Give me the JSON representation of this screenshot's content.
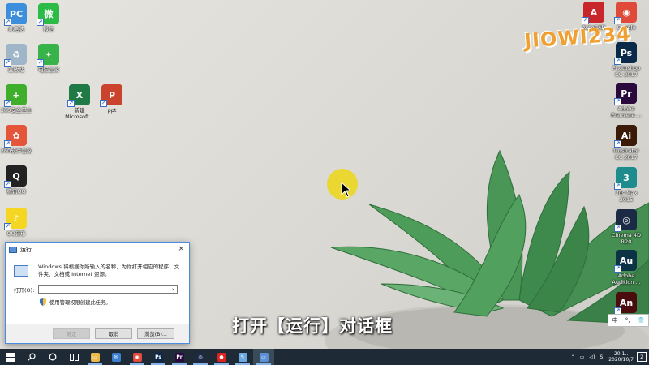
{
  "desktop": {
    "left_icons": [
      {
        "label": "此电脑",
        "color": "#3d8fdc",
        "glyph": "PC"
      },
      {
        "label": "微信",
        "color": "#2dbb47",
        "glyph": "微"
      },
      {
        "label": "回收站",
        "color": "#9fb6c9",
        "glyph": "♻"
      },
      {
        "label": "电脑管家",
        "color": "#37b34a",
        "glyph": "✦"
      },
      {
        "label": "360安全卫士",
        "color": "#3fae2a",
        "glyph": "+"
      },
      {
        "label": "360软件管家",
        "color": "#e4553a",
        "glyph": "✿"
      },
      {
        "label": "腾讯QQ",
        "color": "#222222",
        "glyph": "Q"
      },
      {
        "label": "QQ音乐",
        "color": "#f5d623",
        "glyph": "♪"
      }
    ],
    "mid_icons": [
      {
        "label": "新建\nMicrosoft...",
        "color": "#1f7a45",
        "glyph": "X"
      },
      {
        "label": "ppt",
        "color": "#c9432d",
        "glyph": "P"
      }
    ],
    "right_icons": [
      {
        "label": "AutoCAD",
        "color": "#c8262b",
        "glyph": "A"
      },
      {
        "label": "Google",
        "color": "#e04a3a",
        "glyph": "◉"
      },
      {
        "label": "Photoshop\nCC 2017",
        "color": "#0b2a4a",
        "glyph": "Ps"
      },
      {
        "label": "Adobe\nPremiere ...",
        "color": "#2a0a3d",
        "glyph": "Pr"
      },
      {
        "label": "Illustrator\nCC 2017",
        "color": "#3b1a08",
        "glyph": "Ai"
      },
      {
        "label": "3ds Max\n2015",
        "color": "#1e8c8c",
        "glyph": "3"
      },
      {
        "label": "Cinema 4D\nR20",
        "color": "#1c2b45",
        "glyph": "◎"
      },
      {
        "label": "Adobe\nAudition ...",
        "color": "#0c3345",
        "glyph": "Au"
      },
      {
        "label": "",
        "color": "#4a0c0c",
        "glyph": "An"
      }
    ]
  },
  "watermark": "JIOWI234",
  "run_dialog": {
    "title": "运行",
    "close": "×",
    "description": "Windows 将根据你所输入的名称，为你打开相应的程序、文件夹、文档或 Internet 资源。",
    "open_label": "打开(O):",
    "input_value": "",
    "admin_text": "使用管理权限创建此任务。",
    "ok_label": "确定",
    "cancel_label": "取消",
    "browse_label": "浏览(B)..."
  },
  "caption": "打开【运行】对话框",
  "ime": {
    "lang": "中",
    "punct": "°,",
    "skin": "👕"
  },
  "taskbar": {
    "apps": [
      {
        "name": "file-explorer",
        "color": "#e8b84a",
        "glyph": "▭",
        "active": true
      },
      {
        "name": "mail",
        "color": "#3a7fd0",
        "glyph": "✉",
        "active": false
      },
      {
        "name": "chrome",
        "color": "#e04a3a",
        "glyph": "◉",
        "active": true
      },
      {
        "name": "photoshop",
        "color": "#0b2a4a",
        "glyph": "Ps",
        "active": true
      },
      {
        "name": "premiere",
        "color": "#2a0a3d",
        "glyph": "Pr",
        "active": true
      },
      {
        "name": "cinema4d",
        "color": "#1c2b45",
        "glyph": "◎",
        "active": true
      },
      {
        "name": "recorder",
        "color": "#d22",
        "glyph": "●",
        "active": true
      },
      {
        "name": "notepad",
        "color": "#6aa9e0",
        "glyph": "✎",
        "active": true
      },
      {
        "name": "run",
        "color": "#5b8fd6",
        "glyph": "▭",
        "active": true
      }
    ],
    "tray_text": "S",
    "time": "20:1..",
    "date": "2020/10/7",
    "notifications": "2"
  }
}
